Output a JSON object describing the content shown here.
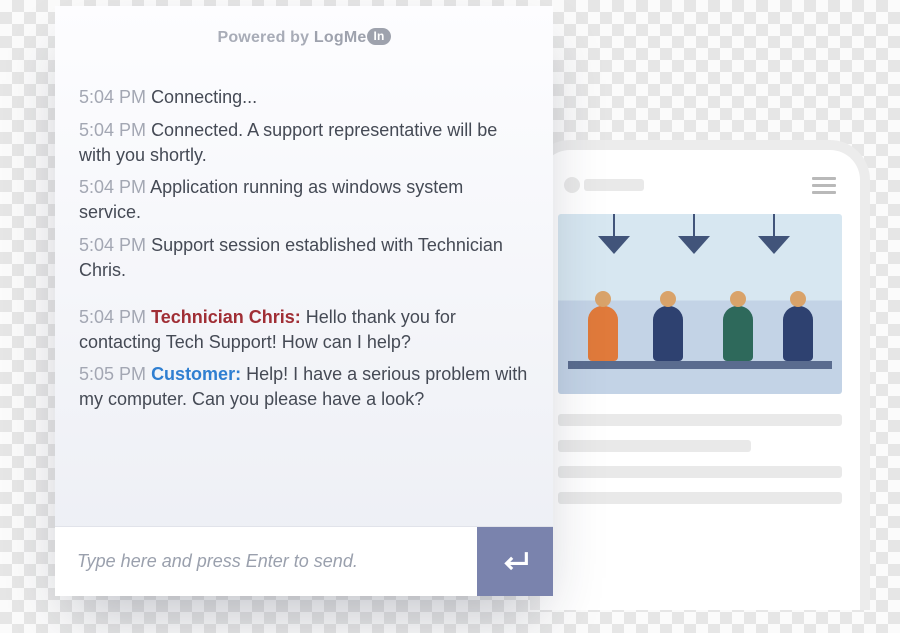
{
  "brand": {
    "powered_prefix": "Powered by ",
    "powered_logo_main": "LogMe",
    "powered_logo_pill": "In"
  },
  "chat": {
    "messages": [
      {
        "time": "5:04 PM",
        "sender": null,
        "text": "Connecting..."
      },
      {
        "time": "5:04 PM",
        "sender": null,
        "text": "Connected. A support representative will be with you shortly."
      },
      {
        "time": "5:04 PM",
        "sender": null,
        "text": "Application running as windows system service."
      },
      {
        "time": "5:04 PM",
        "sender": null,
        "text": "Support session established with Technician Chris."
      },
      {
        "time": "5:04 PM",
        "sender": "tech",
        "who": "Technician Chris:",
        "text": "Hello thank you for contacting Tech Support! How can I help?"
      },
      {
        "time": "5:05 PM",
        "sender": "cust",
        "who": "Customer:",
        "text": "Help! I have a serious problem with my computer. Can you please have a look?"
      }
    ],
    "input": {
      "placeholder": "Type here and press Enter to send.",
      "value": ""
    }
  },
  "colors": {
    "timestamp": "#a3a7b3",
    "technician": "#a02e35",
    "customer": "#2f7fd1",
    "send_button": "#7a83ad"
  }
}
